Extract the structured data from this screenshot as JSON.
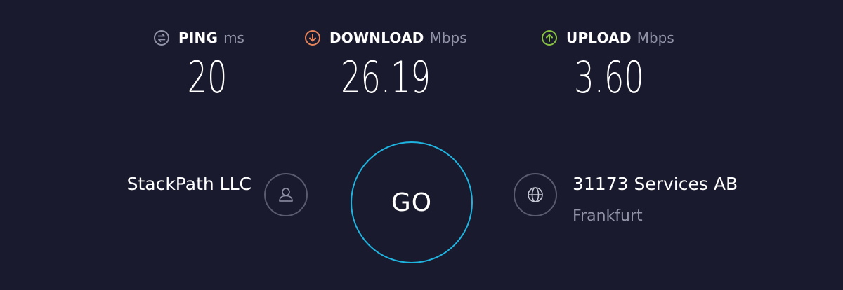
{
  "metrics": {
    "ping": {
      "label": "PING",
      "unit": "ms",
      "value": "20",
      "icon": "ping-icon",
      "color": "#9193a8"
    },
    "download": {
      "label": "DOWNLOAD",
      "unit": "Mbps",
      "value": "26.19",
      "icon": "download-arrow-icon",
      "color": "#e6835a"
    },
    "upload": {
      "label": "UPLOAD",
      "unit": "Mbps",
      "value": "3.60",
      "icon": "upload-arrow-icon",
      "color": "#86c13f"
    }
  },
  "provider": {
    "name": "StackPath LLC",
    "icon": "user-icon"
  },
  "go_button": {
    "label": "GO",
    "ring_color": "#1fb4e0"
  },
  "server": {
    "name": "31173 Services AB",
    "location": "Frankfurt",
    "icon": "globe-icon"
  },
  "colors": {
    "background": "#1a1a2e",
    "muted_text": "#9193a8",
    "icon_ring": "#5a5b6e"
  }
}
